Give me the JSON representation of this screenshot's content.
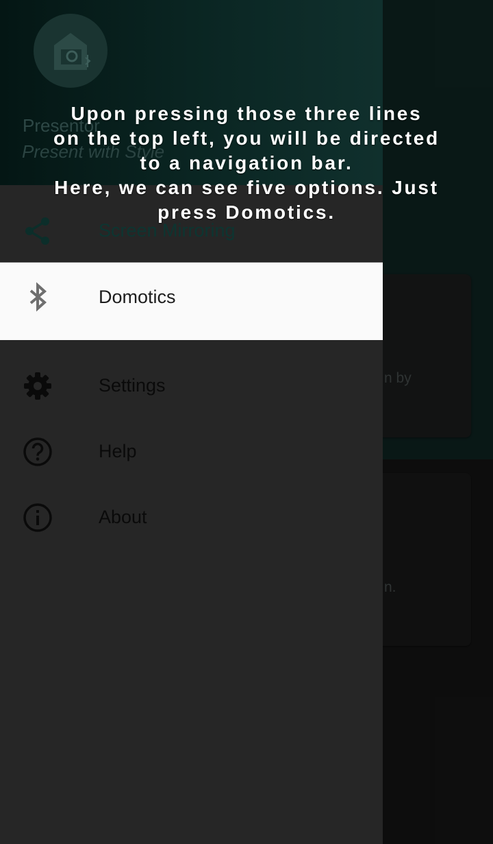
{
  "app": {
    "name": "Presentor",
    "tagline": "Present with Style"
  },
  "drawer": {
    "items": [
      {
        "label": "Screen Mirroring",
        "icon": "share-icon",
        "selected": false
      },
      {
        "label": "Domotics",
        "icon": "bluetooth-icon",
        "selected": true
      },
      {
        "label": "Settings",
        "icon": "gear-icon",
        "selected": false
      },
      {
        "label": "Help",
        "icon": "help-circle-icon",
        "selected": false
      },
      {
        "label": "About",
        "icon": "info-circle-icon",
        "selected": false
      }
    ]
  },
  "background": {
    "card1_fragment": "n by",
    "card2_fragment": "n."
  },
  "overlay": {
    "lines": [
      "Upon pressing those three lines",
      "on the top left, you will be directed",
      "to a navigation bar.",
      "Here, we can see five options. Just",
      "press Domotics."
    ]
  },
  "colors": {
    "header_accent": "#0c1e1c",
    "drawer_bg": "#262626",
    "selected_bg": "#fafafa",
    "caption_text": "#ffffff"
  }
}
